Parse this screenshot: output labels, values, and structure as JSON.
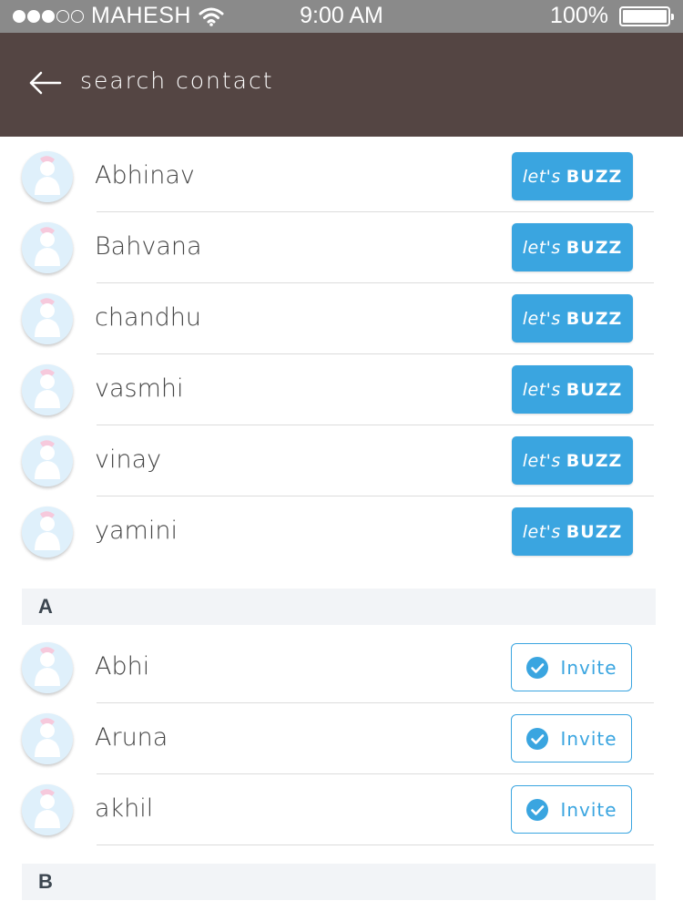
{
  "status_bar": {
    "carrier": "MAHESH",
    "time": "9:00 AM",
    "battery": "100%",
    "signal_bars_filled": 3,
    "signal_bars_total": 5
  },
  "header": {
    "title": "search contact",
    "back_icon": "arrow-left-icon"
  },
  "buzz_button": {
    "prefix": "let's",
    "label": "BUZZ"
  },
  "invite_button": {
    "label": "Invite",
    "icon": "check-circle-icon"
  },
  "app_contacts": [
    {
      "name": "Abhinav"
    },
    {
      "name": "Bahvana"
    },
    {
      "name": "chandhu"
    },
    {
      "name": "vasmhi"
    },
    {
      "name": "vinay"
    },
    {
      "name": "yamini"
    }
  ],
  "sections": [
    {
      "letter": "A",
      "contacts": [
        {
          "name": "Abhi"
        },
        {
          "name": "Aruna"
        },
        {
          "name": "akhil"
        }
      ]
    },
    {
      "letter": "B",
      "contacts": []
    }
  ],
  "colors": {
    "status_bar": "#8a8a8a",
    "header": "#544543",
    "accent": "#3aa5e0",
    "section_bg": "#f2f4f7"
  }
}
